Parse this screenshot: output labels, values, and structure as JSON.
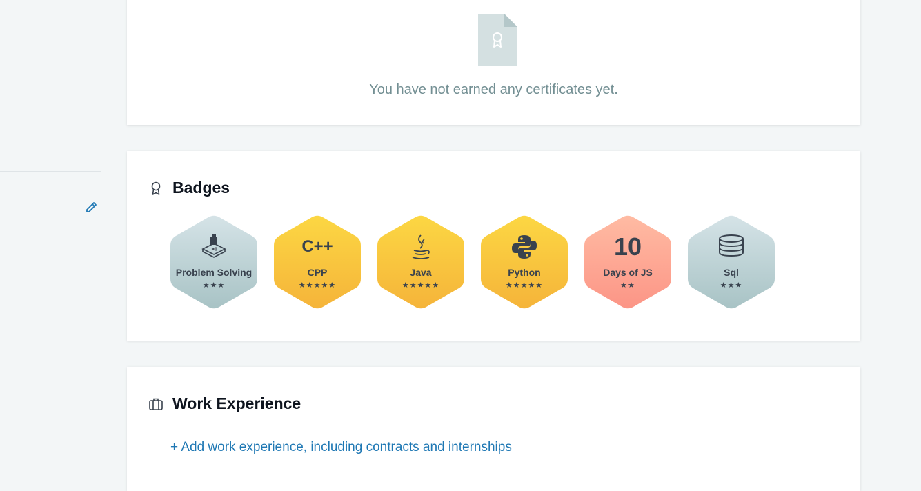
{
  "certificates": {
    "empty_message": "You have not earned any certificates yet."
  },
  "badges": {
    "title": "Badges",
    "items": [
      {
        "name": "Problem Solving",
        "stars": "★★★",
        "star_count": 3,
        "icon": "problem-solving-icon",
        "fill": "gray"
      },
      {
        "name": "CPP",
        "stars": "★★★★★",
        "star_count": 5,
        "icon": "cpp-icon",
        "icon_text": "C++",
        "fill": "gold"
      },
      {
        "name": "Java",
        "stars": "★★★★★",
        "star_count": 5,
        "icon": "java-icon",
        "fill": "gold"
      },
      {
        "name": "Python",
        "stars": "★★★★★",
        "star_count": 5,
        "icon": "python-icon",
        "fill": "gold"
      },
      {
        "name": "Days of JS",
        "stars": "★★",
        "star_count": 2,
        "icon": "ten-days-icon",
        "icon_text": "10",
        "fill": "salmon"
      },
      {
        "name": "Sql",
        "stars": "★★★",
        "star_count": 3,
        "icon": "database-icon",
        "fill": "gray"
      }
    ]
  },
  "work_experience": {
    "title": "Work Experience",
    "add_link": "+ Add work experience, including contracts and internships"
  },
  "colors": {
    "gold_top": "#fbd23f",
    "gold_bottom": "#f5b83a",
    "gray_top": "#d3e2e6",
    "gray_bottom": "#a8c2c6",
    "salmon_top": "#ffb9a1",
    "salmon_bottom": "#fc9a89",
    "link": "#1f78b4"
  }
}
